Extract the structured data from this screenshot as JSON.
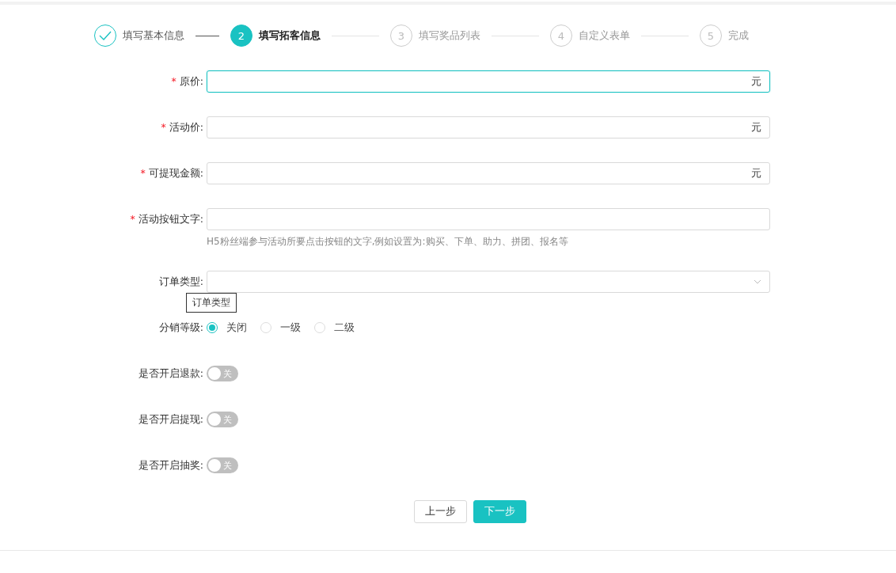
{
  "steps": [
    {
      "title": "填写基本信息",
      "completed": true,
      "selected": false
    },
    {
      "number": "2",
      "title": "填写拓客信息",
      "completed": false,
      "selected": true
    },
    {
      "number": "3",
      "title": "填写奖品列表",
      "completed": false,
      "selected": false
    },
    {
      "number": "4",
      "title": "自定义表单",
      "completed": false,
      "selected": false
    },
    {
      "number": "5",
      "title": "完成",
      "completed": false,
      "selected": false
    }
  ],
  "form": [
    {
      "kind": "input",
      "required_mark": "*",
      "label": "原价:",
      "focused": true,
      "suffix": "元"
    },
    {
      "kind": "input",
      "required_mark": "*",
      "label": "活动价:",
      "focused": false,
      "suffix": "元"
    },
    {
      "kind": "input",
      "required_mark": "*",
      "label": "可提现金额:",
      "focused": false,
      "suffix": "元"
    },
    {
      "kind": "input",
      "required_mark": "*",
      "label": "活动按钮文字:",
      "focused": false,
      "hint": "H5粉丝端参与活动所要点击按钮的文字,例如设置为:购买、下单、助力、拼团、报名等"
    },
    {
      "kind": "select",
      "label": "订单类型:",
      "focused": false,
      "tooltip": "订单类型"
    },
    {
      "kind": "radio",
      "label": "分销等级:",
      "options": [
        {
          "label": "关闭",
          "selected": true
        },
        {
          "label": "一级",
          "selected": false
        },
        {
          "label": "二级",
          "selected": false
        }
      ]
    },
    {
      "kind": "switch",
      "label": "是否开启退款:",
      "on": false,
      "text": "关"
    },
    {
      "kind": "switch",
      "label": "是否开启提现:",
      "on": false,
      "text": "关"
    },
    {
      "kind": "switch",
      "label": "是否开启抽奖:",
      "on": false,
      "text": "关"
    }
  ],
  "buttons": [
    {
      "label": "上一步",
      "primary": false
    },
    {
      "label": "下一步",
      "primary": true
    }
  ]
}
